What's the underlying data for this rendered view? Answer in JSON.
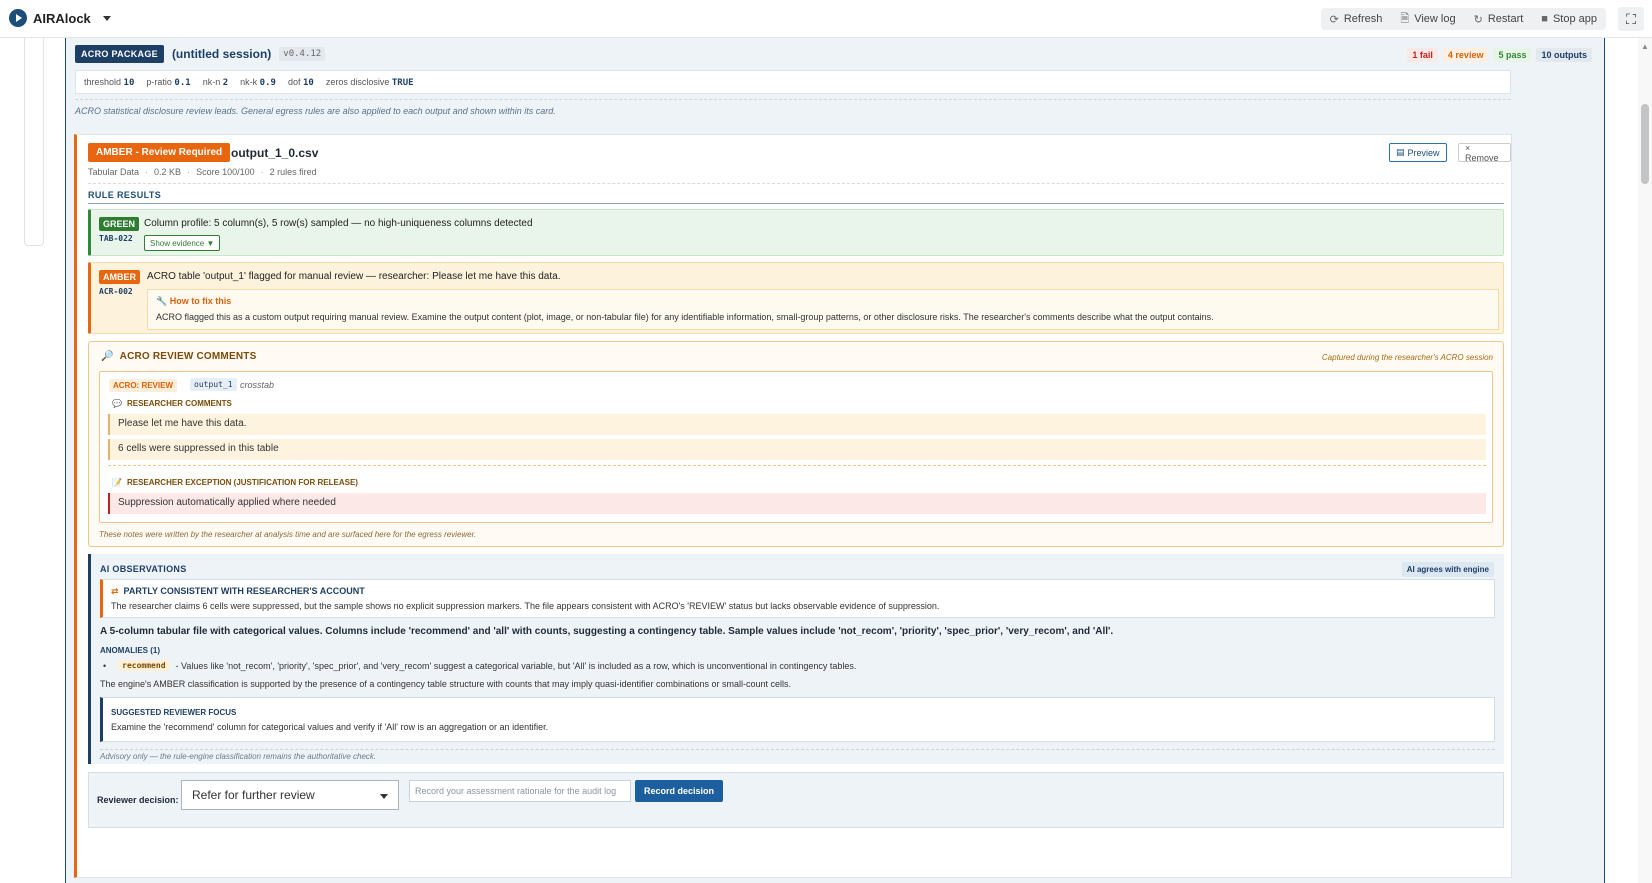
{
  "app": {
    "name": "AIRAlock"
  },
  "toolbar": {
    "actions": [
      {
        "label": "Refresh",
        "icon": "refresh-icon",
        "glyph": "⟳"
      },
      {
        "label": "View log",
        "icon": "file-icon",
        "glyph": "🗎"
      },
      {
        "label": "Restart",
        "icon": "restart-icon",
        "glyph": "↻"
      },
      {
        "label": "Stop app",
        "icon": "stop-icon",
        "glyph": "■"
      }
    ],
    "fullscreen_glyph": "⛶"
  },
  "package": {
    "badge": "ACRO PACKAGE",
    "title": "(untitled session)",
    "version": "v0.4.12",
    "stats": {
      "fail": "1 fail",
      "review": "4 review",
      "pass": "5 pass",
      "outputs": "10 outputs"
    },
    "thresholds": [
      {
        "label": "threshold",
        "value": "10"
      },
      {
        "label": "p-ratio",
        "value": "0.1"
      },
      {
        "label": "nk-n",
        "value": "2"
      },
      {
        "label": "nk-k",
        "value": "0.9"
      },
      {
        "label": "dof",
        "value": "10"
      },
      {
        "label": "zeros disclosive",
        "value": "TRUE"
      }
    ],
    "note": "ACRO statistical disclosure review leads. General egress rules are also applied to each output and shown within its card."
  },
  "output": {
    "status_badge": "AMBER - Review Required",
    "filename": "output_1_0.csv",
    "meta": [
      "Tabular Data",
      "0.2 KB",
      "Score 100/100",
      "2 rules fired"
    ],
    "preview_label": "Preview",
    "preview_glyph": "▤",
    "remove_label": "× Remove",
    "rule_results_heading": "RULE RESULTS",
    "rules": [
      {
        "level": "GREEN",
        "code": "TAB-022",
        "text": "Column profile: 5 column(s), 5 row(s) sampled — no high-uniqueness columns detected",
        "evidence_label": "Show evidence ▼"
      },
      {
        "level": "AMBER",
        "code": "ACR-002",
        "text": "ACRO table 'output_1' flagged for manual review — researcher: Please let me have this data.",
        "fix_title": "How to fix this",
        "fix_glyph": "🔧",
        "fix_text": "ACRO flagged this as a custom output requiring manual review. Examine the output content (plot, image, or non-tabular file) for any identifiable information, small-group patterns, or other disclosure risks. The researcher's comments describe what the output contains."
      }
    ]
  },
  "acro_comments": {
    "heading": "ACRO REVIEW COMMENTS",
    "heading_glyph": "🔎",
    "captured": "Captured during the researcher's ACRO session",
    "pill": "ACRO: REVIEW",
    "output_name": "output_1",
    "kind": "crosstab",
    "researcher_heading": "RESEARCHER COMMENTS",
    "researcher_glyph": "💬",
    "comments": [
      "Please let me have this data.",
      "6 cells were suppressed in this table"
    ],
    "exception_heading": "RESEARCHER EXCEPTION (JUSTIFICATION FOR RELEASE)",
    "exception_glyph": "📝",
    "exception": "Suppression automatically applied where needed",
    "footnote": "These notes were written by the researcher at analysis time and are surfaced here for the egress reviewer."
  },
  "ai": {
    "heading": "AI OBSERVATIONS",
    "agree_badge": "AI agrees with engine",
    "consistency_title": "PARTLY CONSISTENT WITH RESEARCHER'S ACCOUNT",
    "consistency_glyph": "⇄",
    "consistency_text": "The researcher claims 6 cells were suppressed, but the sample shows no explicit suppression markers. The file appears consistent with ACRO's 'REVIEW' status but lacks observable evidence of suppression.",
    "summary": "A 5-column tabular file with categorical values. Columns include 'recommend' and 'all' with counts, suggesting a contingency table. Sample values include 'not_recom', 'priority', 'spec_prior', 'very_recom', and 'All'.",
    "anomalies_heading": "ANOMALIES (1)",
    "anomalies": [
      {
        "code": "recommend",
        "text": "- Values like 'not_recom', 'priority', 'spec_prior', and 'very_recom' suggest a categorical variable, but 'All' is included as a row, which is unconventional in contingency tables."
      }
    ],
    "engine_note": "The engine's AMBER classification is supported by the presence of a contingency table structure with counts that may imply quasi-identifier combinations or small-count cells.",
    "focus_heading": "SUGGESTED REVIEWER FOCUS",
    "focus_text": "Examine the 'recommend' column for categorical values and verify if 'All' row is an aggregation or an identifier.",
    "footnote": "Advisory only — the rule-engine classification remains the authoritative check."
  },
  "decision": {
    "label": "Reviewer decision:",
    "selected": "Refer for further review",
    "rationale_placeholder": "Record your assessment rationale for the audit log",
    "button": "Record decision"
  },
  "colors": {
    "navy": "#1d3f66",
    "amber": "#e8660f",
    "green": "#2f7d33",
    "fail": "#c0231f"
  }
}
